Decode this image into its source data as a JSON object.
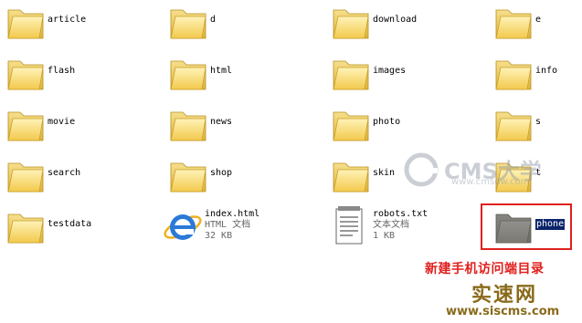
{
  "folders": [
    {
      "name": "article"
    },
    {
      "name": "d"
    },
    {
      "name": "download"
    },
    {
      "name": "e"
    },
    {
      "name": "flash"
    },
    {
      "name": "html"
    },
    {
      "name": "images"
    },
    {
      "name": "info"
    },
    {
      "name": "movie"
    },
    {
      "name": "news"
    },
    {
      "name": "photo"
    },
    {
      "name": "s"
    },
    {
      "name": "search"
    },
    {
      "name": "shop"
    },
    {
      "name": "skin"
    },
    {
      "name": "t"
    },
    {
      "name": "testdata"
    }
  ],
  "files": {
    "index": {
      "name": "index.html",
      "type": "HTML 文档",
      "size": "32 KB"
    },
    "robots": {
      "name": "robots.txt",
      "type": "文本文档",
      "size": "1 KB"
    }
  },
  "selected_folder": {
    "name": "phone"
  },
  "annotation": {
    "caption": "新建手机访问端目录",
    "brand": "实速网",
    "brand_url": "www.siscms.com"
  },
  "watermark": {
    "text": "CMS大学",
    "url": "www.cmsdw.com"
  },
  "colors": {
    "selection": "#0a246a",
    "highlight_box": "#e02020",
    "folder": "#f5d36a"
  }
}
